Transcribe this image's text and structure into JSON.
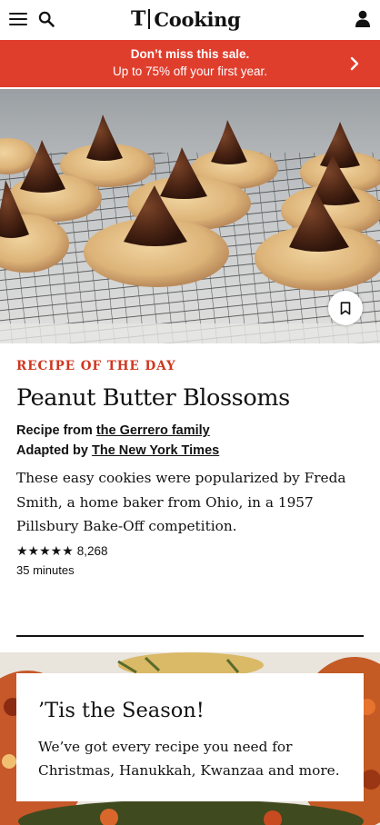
{
  "header": {
    "logo_mark": "T",
    "logo_text": "Cooking",
    "icons": [
      "menu-icon",
      "search-icon",
      "account-icon"
    ]
  },
  "promo_banner": {
    "line1": "Don’t miss this sale.",
    "line2": "Up to 75% off your first year.",
    "background": "#e03e2d",
    "icon": "chevron-right-icon"
  },
  "recipe_of_the_day": {
    "eyebrow": "RECIPE OF THE DAY",
    "title": "Peanut Butter Blossoms",
    "credit_prefix": "Recipe from ",
    "credit_name": "the Gerrero family",
    "adapted_prefix": "Adapted by ",
    "adapted_name": "The New York Times",
    "description": "These easy cookies were popularized by Freda Smith, a home baker from Ohio, in a 1957 Pillsbury Bake-Off competition.",
    "stars": "★★★★★",
    "rating_count": "8,268",
    "time": "35 minutes",
    "save_icon": "bookmark-icon",
    "accent": "#d0361e"
  },
  "season_promo": {
    "title": "’Tis the Season!",
    "text": "We’ve got every recipe you need for Christmas, Hanukkah, Kwanzaa and more."
  }
}
